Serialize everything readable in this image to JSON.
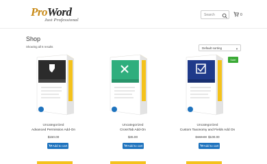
{
  "header": {
    "logo_text_a": "Pro",
    "logo_text_b": "Word",
    "logo_tagline": "Just Professional",
    "search_placeholder": "Search",
    "cart_count": "0"
  },
  "shop": {
    "title": "Shop",
    "results": "Showing all 6 results",
    "sort_value": "Default sorting"
  },
  "products": [
    {
      "category": "Uncategorized",
      "name": "Advanced Permission Add-On",
      "price": "$150.00",
      "old_price": "",
      "button": "Add to cart",
      "box_color": "#2b2b2b",
      "icon": "shield-icon"
    },
    {
      "category": "Uncategorized",
      "name": "CrossTab Add-On",
      "price": "$45.00",
      "old_price": "",
      "button": "Add to cart",
      "box_color": "#2fae7d",
      "icon": "shuffle-icon"
    },
    {
      "category": "Uncategorized",
      "name": "Custom Taxonomy and Fields Add On",
      "price": "$100.00",
      "old_price": "$150.00",
      "button": "Add to cart",
      "sale_badge": "Sale!",
      "box_color": "#1f3a8a",
      "icon": "checklist-icon"
    }
  ]
}
